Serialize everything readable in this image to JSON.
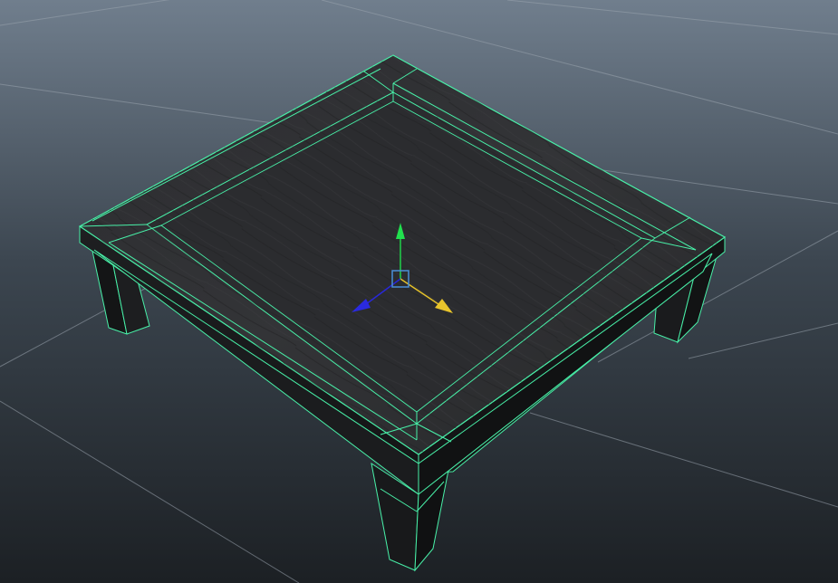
{
  "viewport": {
    "background_top": "#6f7d8c",
    "background_bottom": "#1d2125",
    "grid_color": "#8f9aa5",
    "wire_color": "#48f0a8",
    "wood_color": "#2a2b2d"
  },
  "gizmo": {
    "y_axis_color": "#1fd24a",
    "x_axis_color": "#e4c12a",
    "z_axis_color": "#2828d8",
    "center_color": "#4a8fd8"
  },
  "icons": {
    "y_arrow": "y-axis-arrow-icon",
    "x_arrow": "x-axis-arrow-icon",
    "z_arrow": "z-axis-arrow-icon",
    "center": "manipulator-center-icon"
  }
}
